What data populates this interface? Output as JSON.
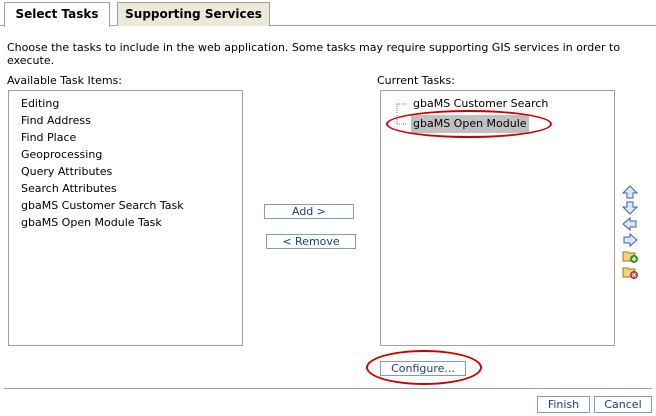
{
  "tabs": [
    {
      "label": "Select Tasks"
    },
    {
      "label": "Supporting Services"
    }
  ],
  "description": "Choose the tasks to include in the web application. Some tasks may require supporting GIS services in order to execute.",
  "available": {
    "label": "Available Task Items:",
    "items": [
      "Editing",
      "Find Address",
      "Find Place",
      "Geoprocessing",
      "Query Attributes",
      "Search Attributes",
      "gbaMS Customer Search Task",
      "gbaMS Open Module Task"
    ]
  },
  "current": {
    "label": "Current Tasks:",
    "items": [
      {
        "label": "gbaMS Customer Search",
        "selected": false
      },
      {
        "label": "gbaMS Open Module",
        "selected": true
      }
    ]
  },
  "buttons": {
    "add": "Add >",
    "remove": "< Remove",
    "configure": "Configure...",
    "finish": "Finish",
    "cancel": "Cancel"
  },
  "side_icons": [
    "move-up-icon",
    "move-down-icon",
    "move-left-icon",
    "move-right-icon",
    "add-folder-icon",
    "remove-folder-icon"
  ],
  "colors": {
    "highlight_ellipse": "#cc0000",
    "selection_bg": "#c0c0c0",
    "button_text": "#1f3a8a"
  }
}
